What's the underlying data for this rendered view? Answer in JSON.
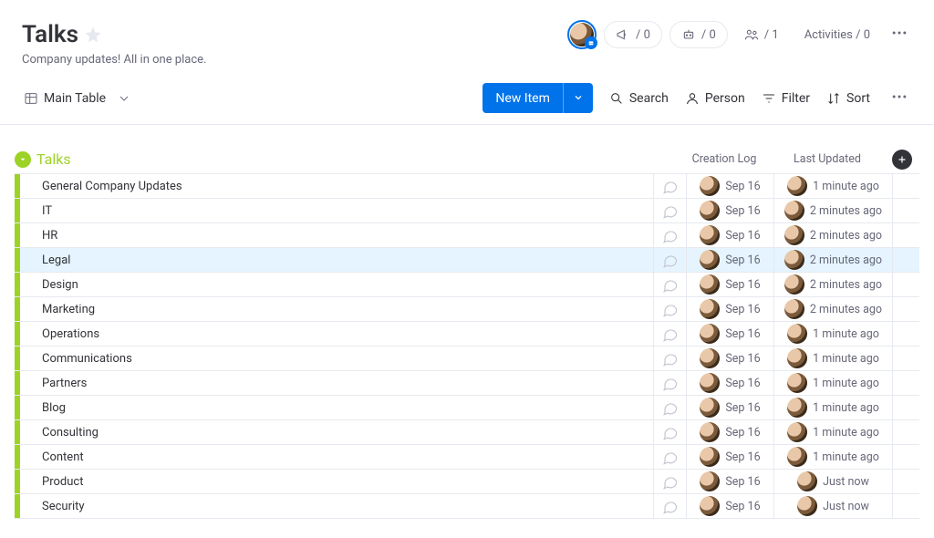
{
  "header": {
    "title": "Talks",
    "subtitle": "Company updates! All in one place.",
    "guests_count": "/ 0",
    "robots_count": "/ 0",
    "members_count": "/ 1",
    "activities_label": "Activities / 0"
  },
  "toolbar": {
    "view_label": "Main Table",
    "new_item_label": "New Item",
    "search_label": "Search",
    "person_label": "Person",
    "filter_label": "Filter",
    "sort_label": "Sort"
  },
  "group": {
    "title": "Talks",
    "accent": "#9cd326",
    "columns": {
      "creation": "Creation Log",
      "updated": "Last Updated"
    }
  },
  "rows": [
    {
      "name": "General Company Updates",
      "created": "Sep 16",
      "updated": "1 minute ago",
      "selected": false
    },
    {
      "name": "IT",
      "created": "Sep 16",
      "updated": "2 minutes ago",
      "selected": false
    },
    {
      "name": "HR",
      "created": "Sep 16",
      "updated": "2 minutes ago",
      "selected": false
    },
    {
      "name": "Legal",
      "created": "Sep 16",
      "updated": "2 minutes ago",
      "selected": true
    },
    {
      "name": "Design",
      "created": "Sep 16",
      "updated": "2 minutes ago",
      "selected": false
    },
    {
      "name": "Marketing",
      "created": "Sep 16",
      "updated": "2 minutes ago",
      "selected": false
    },
    {
      "name": "Operations",
      "created": "Sep 16",
      "updated": "1 minute ago",
      "selected": false
    },
    {
      "name": "Communications",
      "created": "Sep 16",
      "updated": "1 minute ago",
      "selected": false
    },
    {
      "name": "Partners",
      "created": "Sep 16",
      "updated": "1 minute ago",
      "selected": false
    },
    {
      "name": "Blog",
      "created": "Sep 16",
      "updated": "1 minute ago",
      "selected": false
    },
    {
      "name": "Consulting",
      "created": "Sep 16",
      "updated": "1 minute ago",
      "selected": false
    },
    {
      "name": "Content",
      "created": "Sep 16",
      "updated": "1 minute ago",
      "selected": false
    },
    {
      "name": "Product",
      "created": "Sep 16",
      "updated": "Just now",
      "selected": false
    },
    {
      "name": "Security",
      "created": "Sep 16",
      "updated": "Just now",
      "selected": false
    }
  ]
}
